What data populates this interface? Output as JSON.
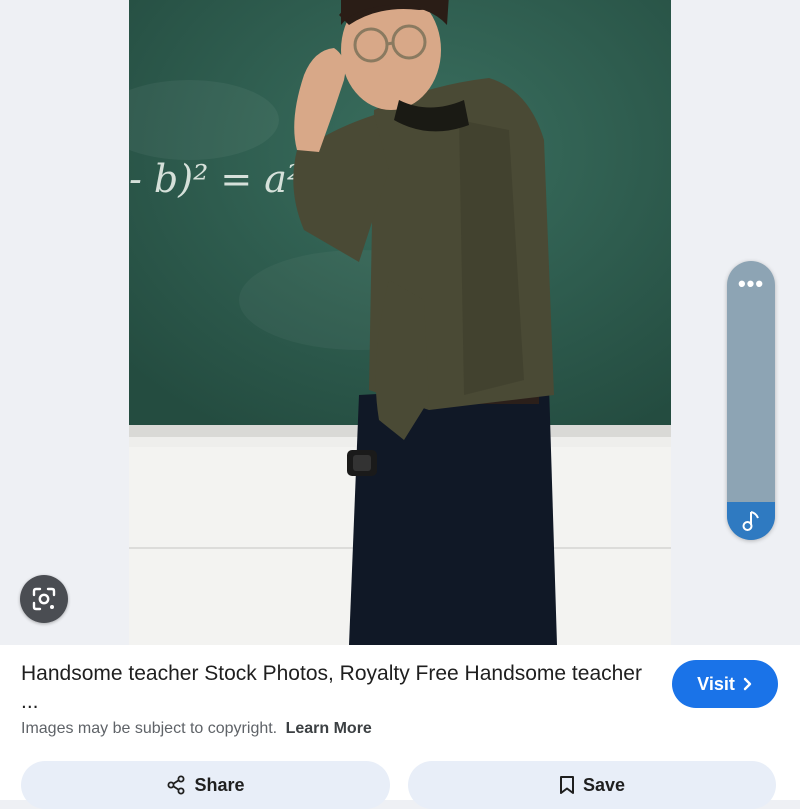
{
  "result": {
    "title": "Handsome teacher Stock Photos, Royalty Free Handsome teacher ...",
    "copyright_text": "Images may be subject to copyright.",
    "learn_more_label": "Learn More",
    "visit_label": "Visit"
  },
  "actions": {
    "share_label": "Share",
    "save_label": "Save"
  },
  "photo": {
    "chalk_text": "- b)² = a² + 2ab +"
  },
  "side_panel": {
    "menu_icon": "more-horizontal-icon",
    "music_icon": "music-note-icon"
  },
  "colors": {
    "accent": "#1a73e8",
    "button_bg": "#e8eef8",
    "chalkboard": "#2e5e4f"
  }
}
